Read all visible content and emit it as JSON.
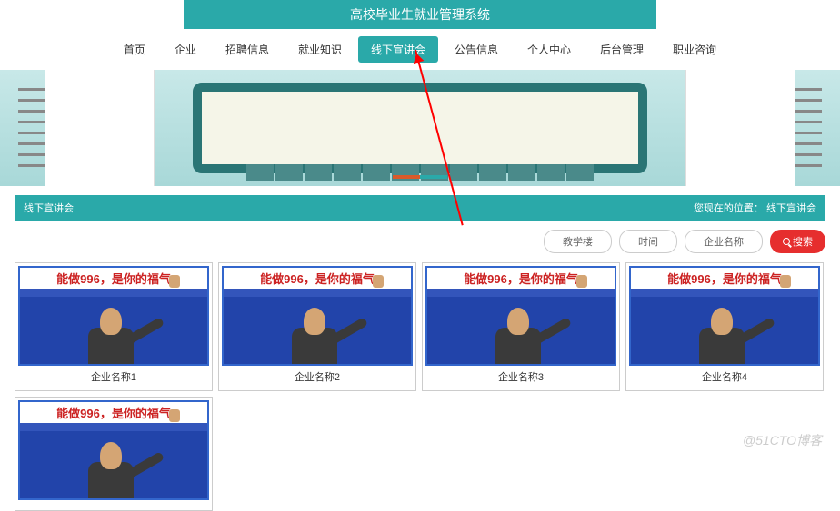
{
  "header": {
    "title": "高校毕业生就业管理系统"
  },
  "nav": {
    "items": [
      {
        "label": "首页"
      },
      {
        "label": "企业"
      },
      {
        "label": "招聘信息"
      },
      {
        "label": "就业知识"
      },
      {
        "label": "线下宣讲会",
        "active": true
      },
      {
        "label": "公告信息"
      },
      {
        "label": "个人中心"
      },
      {
        "label": "后台管理"
      },
      {
        "label": "职业咨询"
      }
    ]
  },
  "section": {
    "title": "线下宣讲会",
    "breadcrumb_label": "您现在的位置：",
    "breadcrumb_current": "线下宣讲会"
  },
  "filters": {
    "f1": "教学楼",
    "f2": "时间",
    "f3": "企业名称",
    "search": "搜索"
  },
  "cards": {
    "meme_text": "能做996，是你的福气",
    "items": [
      {
        "title": "企业名称1"
      },
      {
        "title": "企业名称2"
      },
      {
        "title": "企业名称3"
      },
      {
        "title": "企业名称4"
      },
      {
        "title": ""
      }
    ]
  },
  "watermark": "@51CTO博客"
}
